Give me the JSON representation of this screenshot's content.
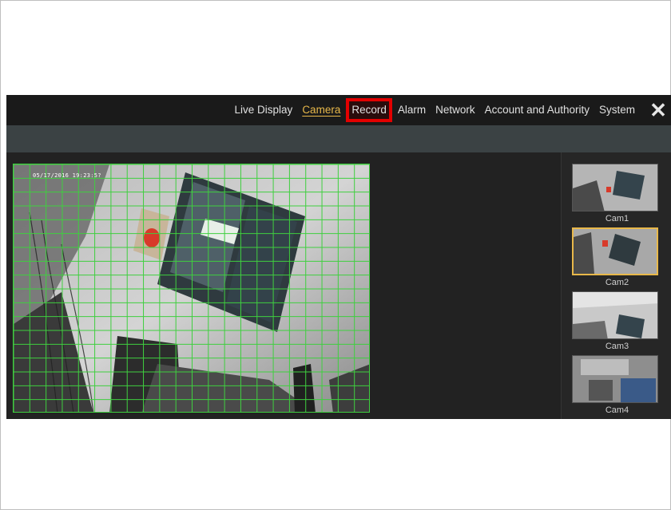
{
  "nav": {
    "items": [
      {
        "label": "Live Display"
      },
      {
        "label": "Camera"
      },
      {
        "label": "Record"
      },
      {
        "label": "Alarm"
      },
      {
        "label": "Network"
      },
      {
        "label": "Account and Authority"
      },
      {
        "label": "System"
      }
    ],
    "active": "Camera",
    "highlighted": "Record",
    "close_icon": "close-icon",
    "active_color": "#e8b84a",
    "highlight_color": "#e30000"
  },
  "preview": {
    "timestamp": "05/17/2016 19:23:5?",
    "grid_color": "#3fcf3f"
  },
  "cameras": [
    {
      "label": "Cam1",
      "selected": false
    },
    {
      "label": "Cam2",
      "selected": true
    },
    {
      "label": "Cam3",
      "selected": false
    },
    {
      "label": "Cam4",
      "selected": false
    }
  ]
}
